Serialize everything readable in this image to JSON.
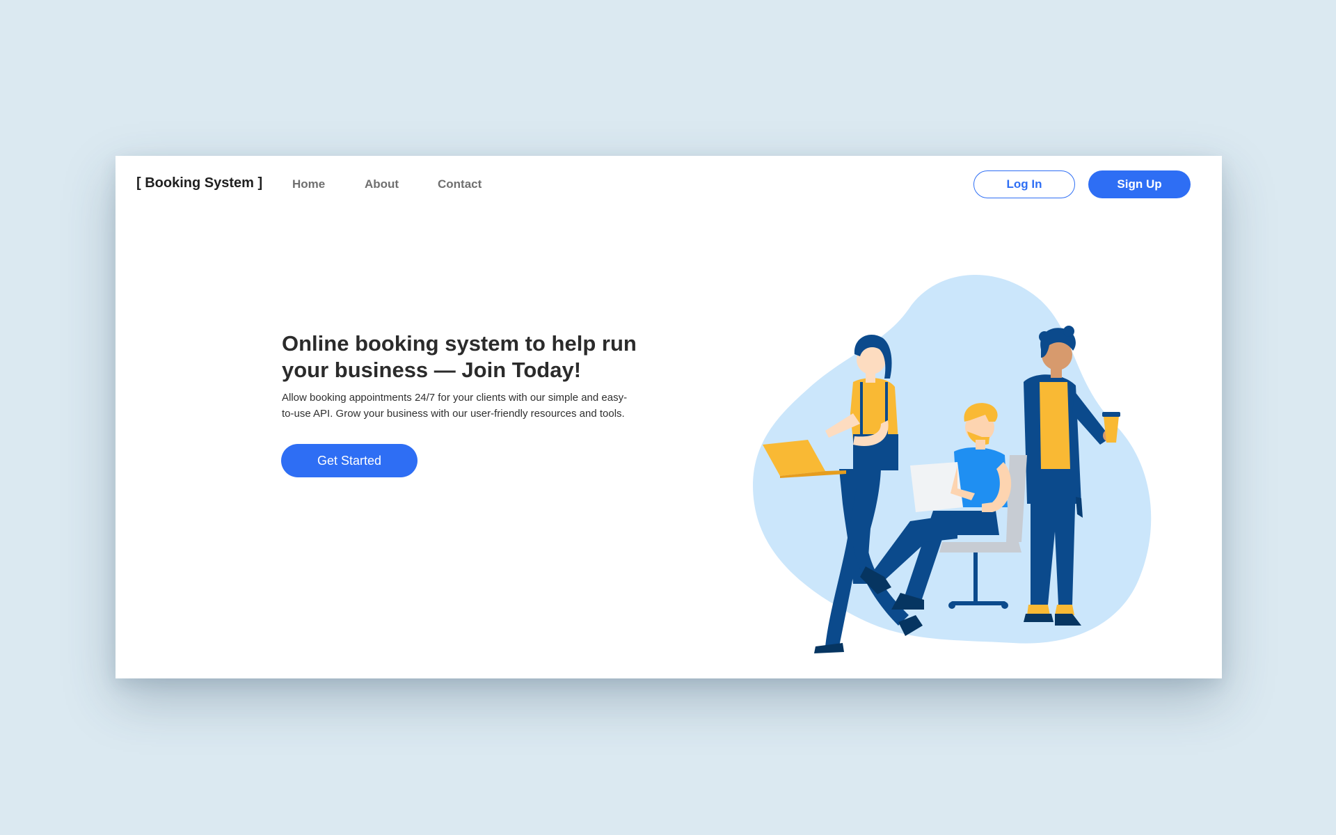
{
  "nav": {
    "logo": "[ Booking System ]",
    "links": [
      "Home",
      "About",
      "Contact"
    ],
    "login_label": "Log In",
    "signup_label": "Sign Up"
  },
  "hero": {
    "title_lines": [
      "Online booking system to help run",
      "your business — Join Today!"
    ],
    "description_lines": [
      "Allow booking appointments 24/7 for your clients with our simple and easy-",
      "to-use API. Grow your business with our user-friendly resources and tools."
    ],
    "cta_label": "Get Started"
  },
  "colors": {
    "page_background": "#dbe9f1",
    "accent": "#2e6ef4",
    "illustration_blob": "#cbe6fb",
    "illustration_yellow": "#f9b934",
    "illustration_navy": "#0b4a8c"
  },
  "icons": [
    "team-illustration"
  ]
}
